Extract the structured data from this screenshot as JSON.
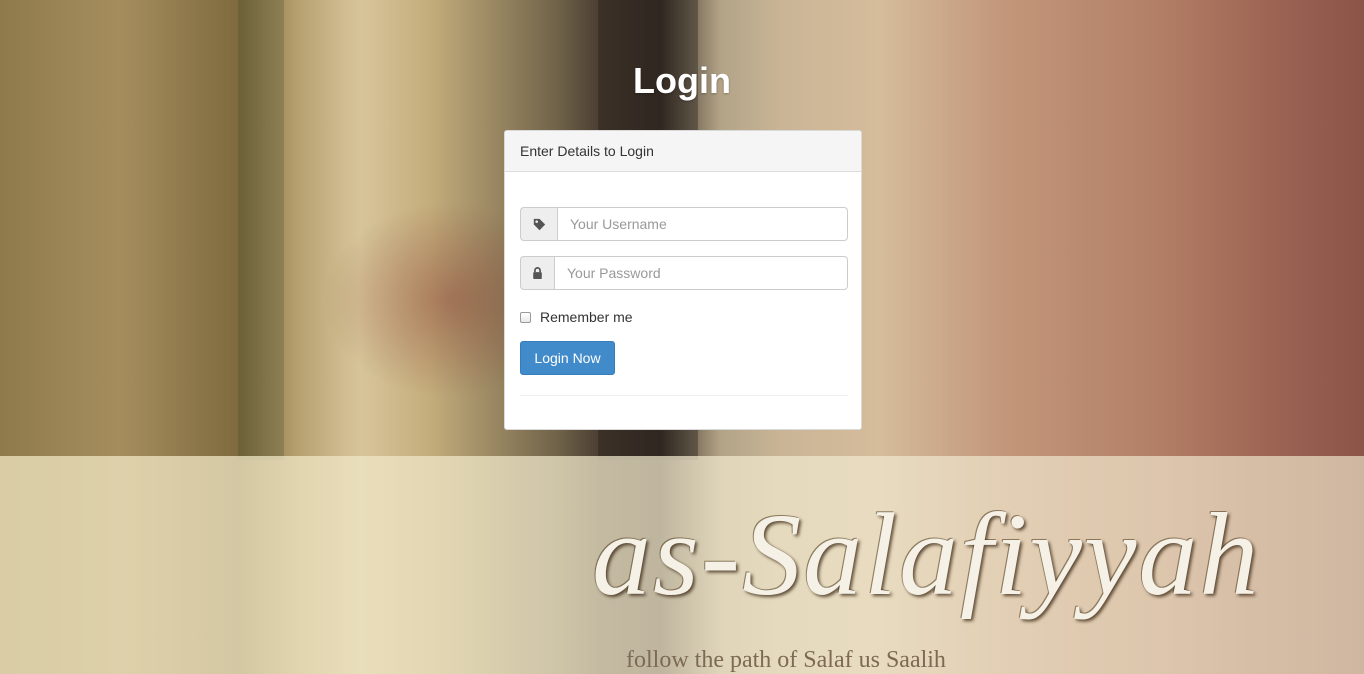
{
  "page": {
    "title": "Login"
  },
  "panel": {
    "heading": "Enter Details to Login",
    "username": {
      "placeholder": "Your Username",
      "icon": "tag-icon"
    },
    "password": {
      "placeholder": "Your Password",
      "icon": "lock-icon"
    },
    "remember_label": "Remember me",
    "remember_checked": false,
    "submit_label": "Login Now"
  },
  "branding": {
    "logo_text": "as-Salafiyyah",
    "tagline": "follow the path of Salaf us Saalih"
  },
  "colors": {
    "primary_button": "#428bca",
    "panel_heading_bg": "#f5f5f5"
  }
}
